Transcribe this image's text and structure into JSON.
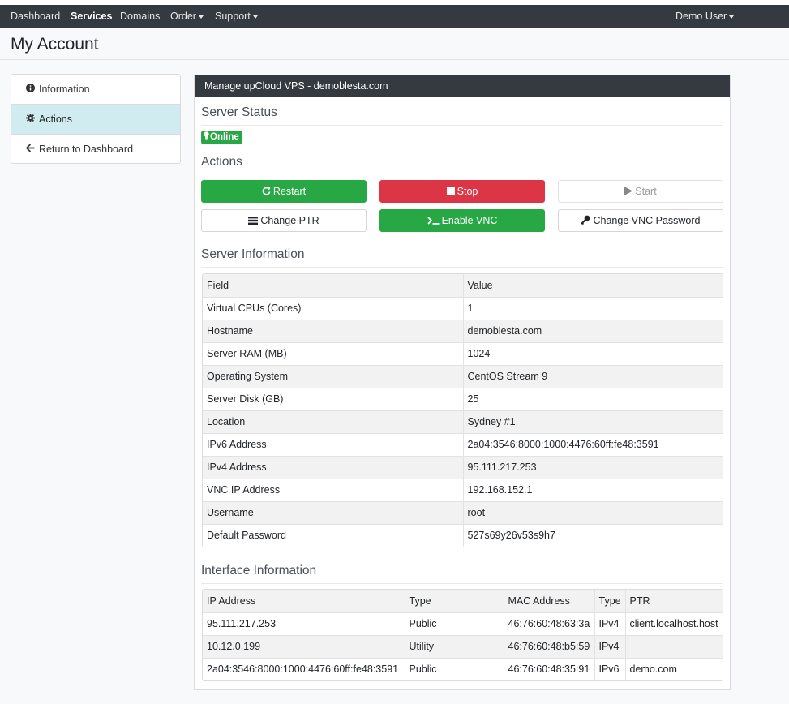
{
  "nav": {
    "items": [
      {
        "label": "Dashboard",
        "dropdown": false,
        "active": false
      },
      {
        "label": "Services",
        "dropdown": false,
        "active": true
      },
      {
        "label": "Domains",
        "dropdown": false,
        "active": false
      },
      {
        "label": "Order",
        "dropdown": true,
        "active": false
      },
      {
        "label": "Support",
        "dropdown": true,
        "active": false
      }
    ],
    "user_label": "Demo User"
  },
  "page": {
    "title": "My Account"
  },
  "sidebar": {
    "items": [
      {
        "label": "Information",
        "icon": "info-circle-icon",
        "active": false
      },
      {
        "label": "Actions",
        "icon": "gear-icon",
        "active": true
      },
      {
        "label": "Return to Dashboard",
        "icon": "arrow-left-icon",
        "active": false
      }
    ]
  },
  "panel": {
    "title": "Manage upCloud VPS - demoblesta.com",
    "status_title": "Server Status",
    "status_badge": "Online",
    "actions_title": "Actions",
    "buttons": {
      "restart": "Restart",
      "stop": "Stop",
      "start": "Start",
      "change_ptr": "Change PTR",
      "enable_vnc": "Enable VNC",
      "change_vnc_password": "Change VNC Password"
    },
    "server_info_title": "Server Information",
    "server_info": {
      "headers": [
        "Field",
        "Value"
      ],
      "rows": [
        [
          "Virtual CPUs (Cores)",
          "1"
        ],
        [
          "Hostname",
          "demoblesta.com"
        ],
        [
          "Server RAM (MB)",
          "1024"
        ],
        [
          "Operating System",
          "CentOS Stream 9"
        ],
        [
          "Server Disk (GB)",
          "25"
        ],
        [
          "Location",
          "Sydney #1"
        ],
        [
          "IPv6 Address",
          "2a04:3546:8000:1000:4476:60ff:fe48:3591"
        ],
        [
          "IPv4 Address",
          "95.111.217.253"
        ],
        [
          "VNC IP Address",
          "192.168.152.1"
        ],
        [
          "Username",
          "root"
        ],
        [
          "Default Password",
          "527s69y26v53s9h7"
        ]
      ]
    },
    "interface_info_title": "Interface Information",
    "interface_info": {
      "headers": [
        "IP Address",
        "Type",
        "MAC Address",
        "Type",
        "PTR"
      ],
      "rows": [
        [
          "95.111.217.253",
          "Public",
          "46:76:60:48:63:3a",
          "IPv4",
          "client.localhost.host"
        ],
        [
          "10.12.0.199",
          "Utility",
          "46:76:60:48:b5:59",
          "IPv4",
          ""
        ],
        [
          "2a04:3546:8000:1000:4476:60ff:fe48:3591",
          "Public",
          "46:76:60:48:35:91",
          "IPv6",
          "demo.com"
        ]
      ]
    }
  },
  "colors": {
    "navbar": "#343a40",
    "success": "#28a745",
    "danger": "#dc3545",
    "active_sidebar": "#d1ecf1"
  }
}
